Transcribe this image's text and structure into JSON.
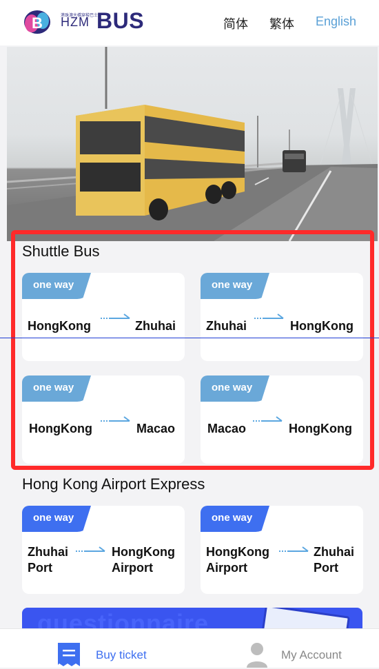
{
  "header": {
    "logo_small": "港珠澳大橋穿梭巴士",
    "logo_hzm": "HZM",
    "logo_bus": "BUS",
    "languages": [
      "简体",
      "繁体",
      "English"
    ],
    "colors": {
      "brand": "#2d2a7a",
      "active_lang": "#5aa0d6"
    }
  },
  "hero": {
    "image": "double-decker-bus-on-bridge"
  },
  "shuttle": {
    "title": "Shuttle Bus",
    "cards": [
      {
        "tag": "one way",
        "from": "HongKong",
        "to": "Zhuhai"
      },
      {
        "tag": "one way",
        "from": "Zhuhai",
        "to": "HongKong"
      },
      {
        "tag": "one way",
        "from": "HongKong",
        "to": "Macao"
      },
      {
        "tag": "one way",
        "from": "Macao",
        "to": "HongKong"
      }
    ]
  },
  "airport": {
    "title": "Hong Kong Airport Express",
    "cards": [
      {
        "tag": "one way",
        "from_1": "Zhuhai",
        "from_2": "Port",
        "to_1": "HongKong",
        "to_2": "Airport"
      },
      {
        "tag": "one way",
        "from_1": "HongKong",
        "from_2": "Airport",
        "to_1": "Zhuhai",
        "to_2": "Port"
      }
    ]
  },
  "banner": {
    "text": "questionnaire"
  },
  "tabbar": {
    "buy_ticket": "Buy ticket",
    "my_account": "My Account",
    "colors": {
      "active": "#3e6ff0",
      "inactive": "#888888"
    }
  }
}
